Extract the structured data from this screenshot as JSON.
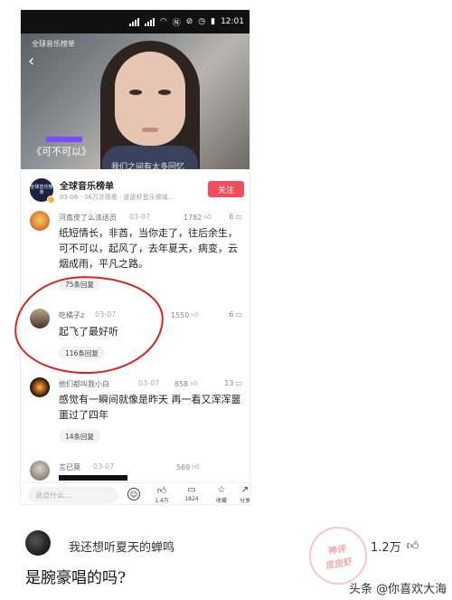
{
  "status_bar": {
    "time": "12:01",
    "indicators": [
      "signal-icon",
      "wifi-icon",
      "nfc-icon",
      "mute-icon",
      "alarm-icon",
      "battery-icon"
    ]
  },
  "video": {
    "channel_tag": "全球音乐榜单",
    "title": "《可不可以》",
    "subtitle": "我们之间有太多回忆"
  },
  "channel": {
    "avatar_text": "全球音乐榜单",
    "name": "全球音乐榜单",
    "meta": "03-06 · 36万次观看 · 皮皮虾音乐领域...",
    "follow_label": "关注"
  },
  "comments": [
    {
      "user": "河南皮了么派送员",
      "date": "03-07",
      "likes": "1782",
      "replies": "6",
      "text": "纸短情长，非酋，当你走了，往后余生，可不可以，起风了，去年夏天，病变，云烟成雨，平凡之路。",
      "reply_label": "75条回复"
    },
    {
      "user": "吃橘子z",
      "date": "03-07",
      "likes": "1550",
      "replies": "6",
      "text": "起飞了最好听",
      "reply_label": "116条回复"
    },
    {
      "user": "他们都叫我小白",
      "date": "03-07",
      "likes": "858",
      "replies": "13",
      "text": "感觉有一瞬间就像是昨天 再一看又浑浑噩噩过了四年",
      "reply_label": "14条回复"
    },
    {
      "user": "言已莫",
      "date": "03-07",
      "likes": "569",
      "replies": "",
      "text": "",
      "reply_label": ""
    }
  ],
  "bottom_bar": {
    "input_placeholder": "说点什么...",
    "like_count": "1.4万",
    "comment_count": "1824",
    "favorite_label": "收藏",
    "share_label": "分享"
  },
  "second_comment": {
    "user": "我还想听夏天的蝉鸣",
    "likes": "1.2万",
    "text": "是腕豪唱的吗?",
    "stamp_top": "神评",
    "stamp_bottom": "皮皮虾"
  },
  "watermark": "头条 @你喜欢大海",
  "colors": {
    "follow_button": "#f04e5d",
    "highlight_circle": "#e0201b"
  }
}
